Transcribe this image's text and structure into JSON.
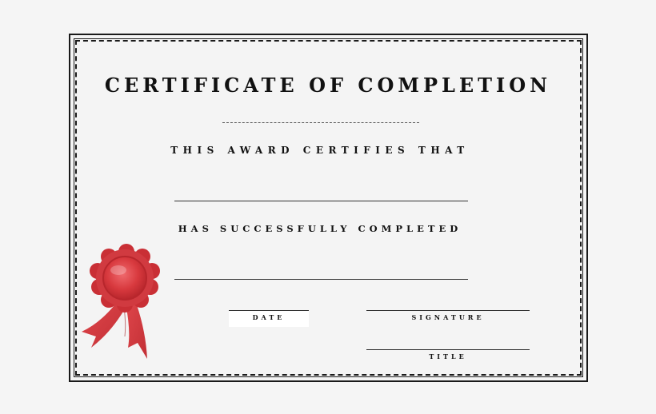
{
  "certificate": {
    "title": "CERTIFICATE OF COMPLETION",
    "certifies_text": "THIS AWARD CERTIFIES THAT",
    "completed_text": "HAS SUCCESSFULLY COMPLETED",
    "date_label": "DATE",
    "signature_label": "SIGNATURE",
    "title_label": "TITLE"
  },
  "colors": {
    "ribbon_red": "#d8393e",
    "ribbon_dark": "#b8262c",
    "border": "#1a1a1a"
  },
  "icons": {
    "seal": "award-ribbon-icon"
  }
}
